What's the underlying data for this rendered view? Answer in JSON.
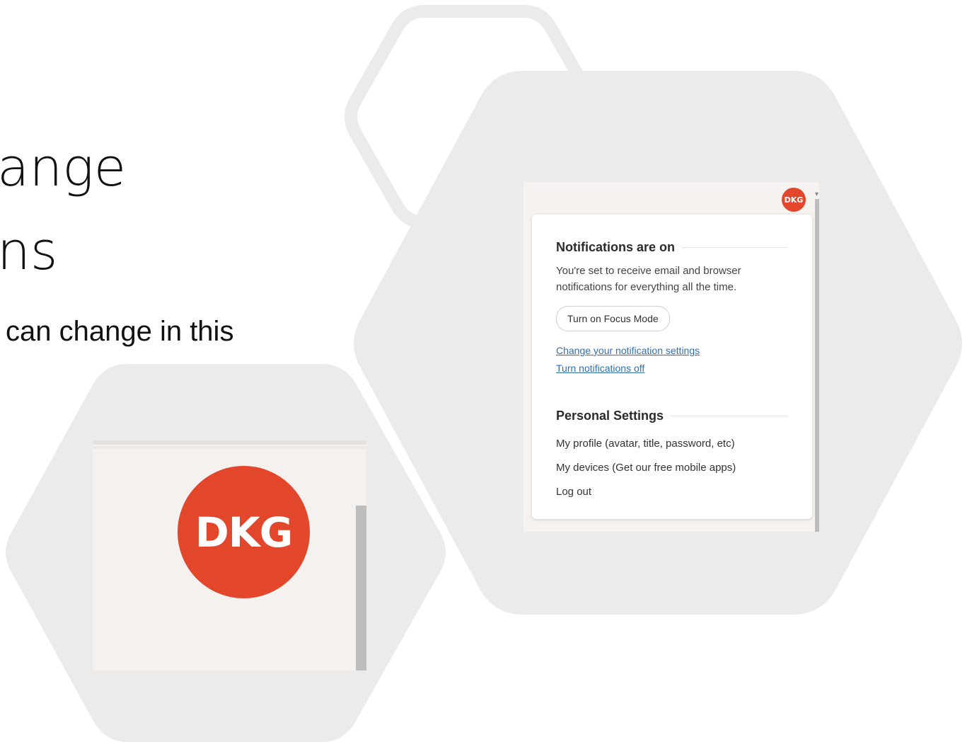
{
  "slide": {
    "title_line_1": "ange",
    "title_line_2": "ns",
    "subtitle": "can change in this"
  },
  "colors": {
    "hexagon_fill": "#ebebeb",
    "avatar_bg": "#e2472c",
    "link": "#2f6fb5"
  },
  "zoom_shot": {
    "avatar_initials": "DKG"
  },
  "menu_shot": {
    "avatar_initials": "DKG",
    "notifications": {
      "heading": "Notifications are on",
      "description": "You're set to receive email and browser notifications for everything all the time.",
      "focus_button": "Turn on Focus Mode",
      "link_settings": "Change your notification settings",
      "link_off": "Turn notifications off"
    },
    "personal": {
      "heading": "Personal Settings",
      "items": [
        "My profile (avatar, title, password, etc)",
        "My devices (Get our free mobile apps)",
        "Log out"
      ]
    }
  }
}
